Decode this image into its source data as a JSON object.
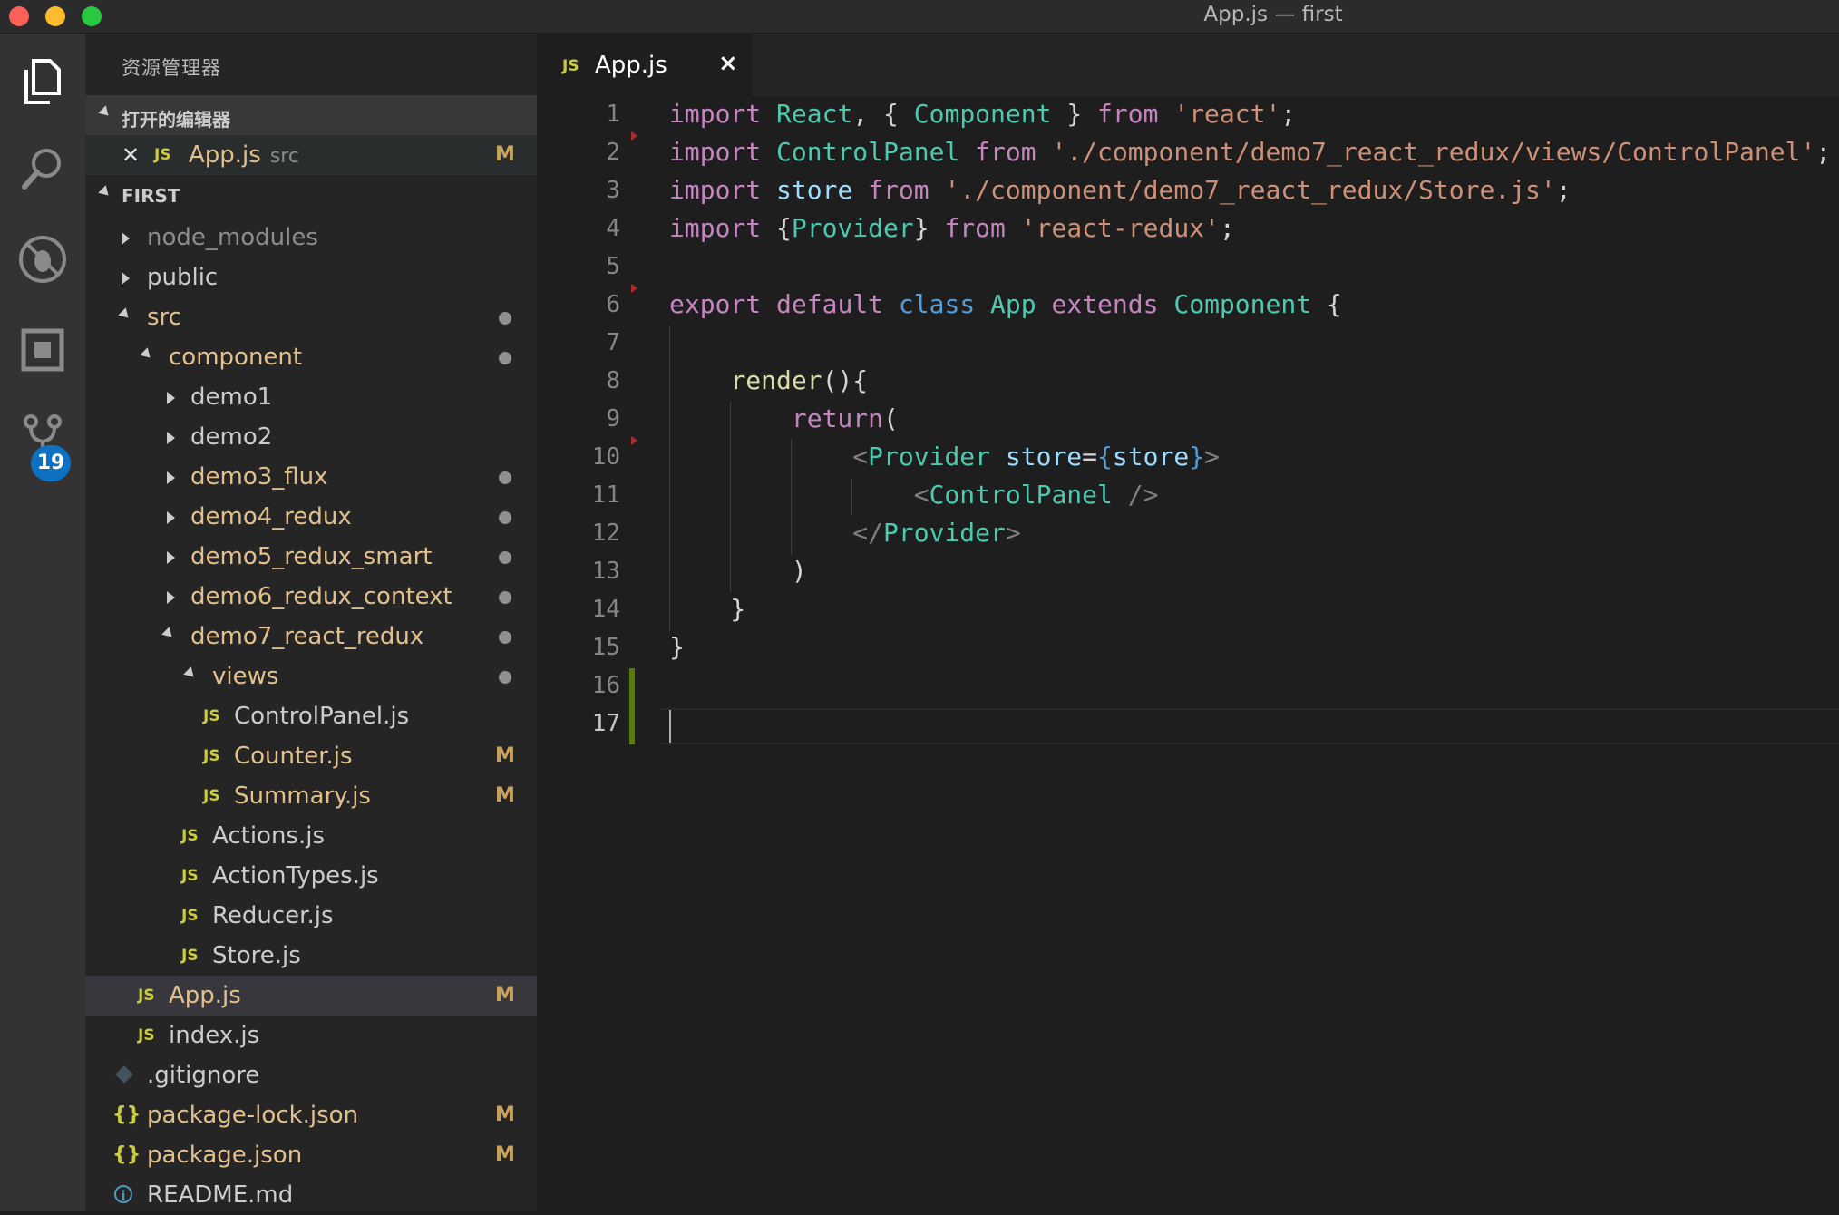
{
  "window": {
    "title": "App.js — first"
  },
  "activity_bar": {
    "icons": [
      "files-icon",
      "search-icon",
      "debug-icon",
      "extensions-icon",
      "source-control-icon"
    ],
    "source_control_badge": "19"
  },
  "sidebar": {
    "title": "资源管理器",
    "open_editors": {
      "header": "打开的编辑器",
      "items": [
        {
          "name": "App.js",
          "path": "src",
          "status": "M"
        }
      ]
    },
    "project": {
      "header": "FIRST",
      "tree": [
        {
          "name": "node_modules",
          "type": "folder",
          "expanded": false,
          "depth": 0
        },
        {
          "name": "public",
          "type": "folder",
          "expanded": false,
          "depth": 0
        },
        {
          "name": "src",
          "type": "folder",
          "expanded": true,
          "depth": 0
        },
        {
          "name": "component",
          "type": "folder",
          "expanded": true,
          "depth": 1
        },
        {
          "name": "demo1",
          "type": "folder",
          "expanded": false,
          "depth": 2
        },
        {
          "name": "demo2",
          "type": "folder",
          "expanded": false,
          "depth": 2
        },
        {
          "name": "demo3_flux",
          "type": "folder",
          "expanded": false,
          "depth": 2
        },
        {
          "name": "demo4_redux",
          "type": "folder",
          "expanded": false,
          "depth": 2
        },
        {
          "name": "demo5_redux_smart",
          "type": "folder",
          "expanded": false,
          "depth": 2
        },
        {
          "name": "demo6_redux_context",
          "type": "folder",
          "expanded": false,
          "depth": 2
        },
        {
          "name": "demo7_react_redux",
          "type": "folder",
          "expanded": true,
          "depth": 2
        },
        {
          "name": "views",
          "type": "folder",
          "expanded": true,
          "depth": 3
        },
        {
          "name": "ControlPanel.js",
          "type": "js",
          "depth": 4
        },
        {
          "name": "Counter.js",
          "type": "js",
          "depth": 4,
          "status": "M"
        },
        {
          "name": "Summary.js",
          "type": "js",
          "depth": 4,
          "status": "M"
        },
        {
          "name": "Actions.js",
          "type": "js",
          "depth": 3
        },
        {
          "name": "ActionTypes.js",
          "type": "js",
          "depth": 3
        },
        {
          "name": "Reducer.js",
          "type": "js",
          "depth": 3
        },
        {
          "name": "Store.js",
          "type": "js",
          "depth": 3
        },
        {
          "name": "App.js",
          "type": "js",
          "depth": 1,
          "status": "M"
        },
        {
          "name": "index.js",
          "type": "js",
          "depth": 1
        },
        {
          "name": ".gitignore",
          "type": "git",
          "depth": 0
        },
        {
          "name": "package-lock.json",
          "type": "json",
          "depth": 0,
          "status": "M"
        },
        {
          "name": "package.json",
          "type": "json",
          "depth": 0,
          "status": "M"
        },
        {
          "name": "README.md",
          "type": "info",
          "depth": 0
        }
      ]
    }
  },
  "editor": {
    "tab": {
      "label": "App.js",
      "icon": "JS",
      "close": "×"
    },
    "line_numbers": [
      "1",
      "2",
      "3",
      "4",
      "5",
      "6",
      "7",
      "8",
      "9",
      "10",
      "11",
      "12",
      "13",
      "14",
      "15",
      "16",
      "17"
    ],
    "current_line": "17",
    "code": [
      "import React, { Component } from 'react';",
      "import ControlPanel from './component/demo7_react_redux/views/ControlPanel';",
      "import store from './component/demo7_react_redux/Store.js';",
      "import {Provider} from 'react-redux';",
      "",
      "export default class App extends Component {",
      "",
      "    render(){",
      "        return(",
      "            <Provider store={store}>",
      "                <ControlPanel />",
      "            </Provider>",
      "        )",
      "    }",
      "}",
      "",
      ""
    ]
  },
  "colors": {
    "keyword": "#c586c0",
    "storage": "#569cd6",
    "class": "#4ec9b0",
    "string": "#ce9178",
    "variable": "#9cdcfe",
    "function": "#dcdcaa",
    "modified": "#e2c08d"
  }
}
